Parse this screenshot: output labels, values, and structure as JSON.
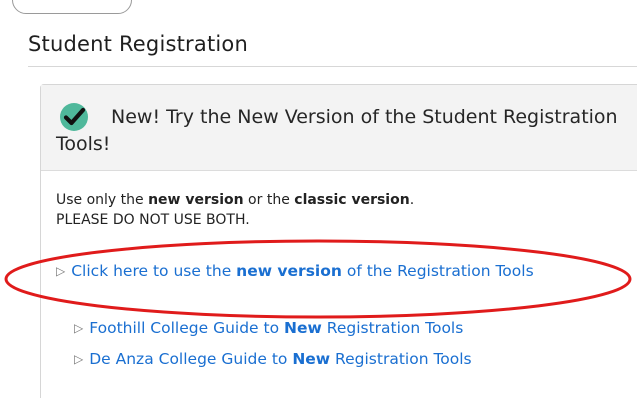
{
  "page": {
    "title": "Student Registration"
  },
  "card": {
    "heading": "New! Try the New Version of the Student Registration Tools!",
    "intro_part1": "Use only the ",
    "intro_bold1": "new version",
    "intro_part2": " or the ",
    "intro_bold2": "classic version",
    "intro_part3": ".",
    "intro_line2": "PLEASE DO NOT USE BOTH.",
    "links": {
      "main": {
        "prefix": "Click here to use the ",
        "bold": "new version",
        "suffix": " of the Registration Tools"
      },
      "foothill": {
        "prefix": "Foothill College Guide to ",
        "bold": "New",
        "suffix": " Registration Tools"
      },
      "deanza": {
        "prefix": "De Anza College Guide to ",
        "bold": "New",
        "suffix": " Registration Tools"
      }
    }
  },
  "icons": {
    "check": "check-circle-icon",
    "disclosure": "triangle-right-icon"
  },
  "colors": {
    "link": "#1a6fd1",
    "check_circle": "#4fb89b",
    "highlight_ellipse": "#e01b1b"
  }
}
